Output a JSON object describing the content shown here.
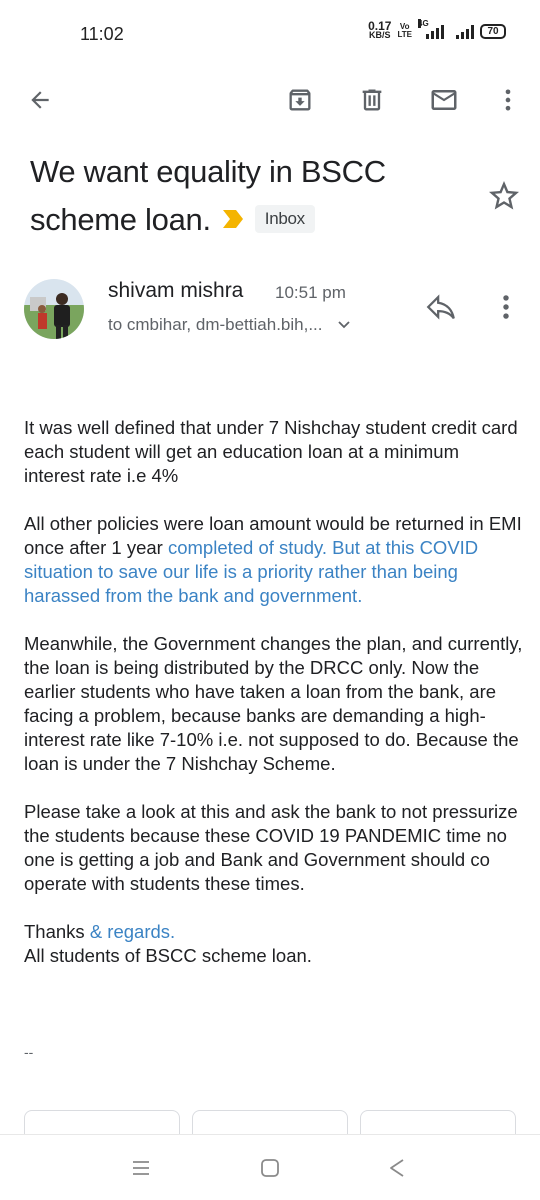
{
  "status_bar": {
    "time": "11:02",
    "net_speed_value": "0.17",
    "net_speed_unit": "KB/S",
    "volte_top": "Vo",
    "volte_bottom": "LTE",
    "network_type": "4G",
    "battery": "70"
  },
  "toolbar": {
    "icons": [
      "back-arrow-icon",
      "archive-icon",
      "delete-icon",
      "mark-unread-icon",
      "more-vert-icon"
    ]
  },
  "email": {
    "subject": "We want equality in BSCC scheme loan.",
    "label": "Inbox",
    "sender_name": "shivam mishra",
    "time": "10:51 pm",
    "recipients": "to cmbihar, dm-bettiah.bih,...",
    "body": {
      "p1": "It was well defined that under 7 Nishchay student credit card each student will get an education loan at a minimum interest rate i.e 4%",
      "p2_plain": "All other policies were loan amount would be returned in EMI once after 1 year ",
      "p2_link": "completed of study. But at this COVID situation to save our life is a priority rather than being harassed from the  bank and government.",
      "p3": "Meanwhile, the Government changes the plan, and currently, the loan is being distributed by the DRCC only. Now the earlier students who have taken a loan from the bank, are facing a problem, because banks are demanding a high-interest rate like 7-10% i.e. not supposed to do. Because the loan is under the 7 Nishchay Scheme.",
      "p4": "Please take a look at this and ask the bank to not pressurize the students because these COVID 19 PANDEMIC time no one is getting a job and Bank and Government should co operate with students these times.",
      "thanks_plain": "Thanks ",
      "thanks_link": "& regards.",
      "closing": "All students of BSCC scheme loan.",
      "signature_separator": "--"
    }
  },
  "colors": {
    "link": "#3b83c4",
    "importance_marker": "#f4b400",
    "chip_bg": "#f1f3f4"
  }
}
